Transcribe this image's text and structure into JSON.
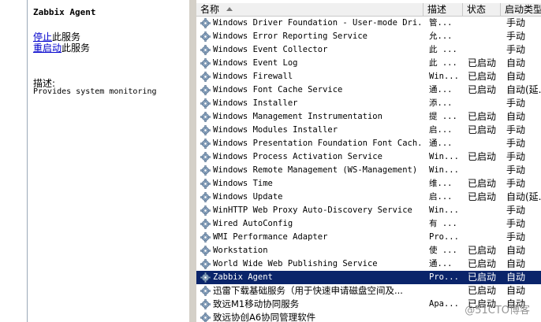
{
  "description_pane": {
    "service_title": "Zabbix Agent",
    "stop_link": "停止",
    "stop_suffix": "此服务",
    "restart_link": "重启动",
    "restart_suffix": "此服务",
    "description_label": "描述:",
    "description_text": "Provides system monitoring"
  },
  "columns": {
    "name": "名称",
    "description": "描述",
    "status": "状态",
    "startup": "启动类型"
  },
  "services": [
    {
      "name": "Windows Driver Foundation - User-mode Dri...",
      "desc": "管...",
      "status": "",
      "startup": "手动"
    },
    {
      "name": "Windows Error Reporting Service",
      "desc": "允...",
      "status": "",
      "startup": "手动"
    },
    {
      "name": "Windows Event Collector",
      "desc": "此 ...",
      "status": "",
      "startup": "手动"
    },
    {
      "name": "Windows Event Log",
      "desc": "此 ...",
      "status": "已启动",
      "startup": "自动"
    },
    {
      "name": "Windows Firewall",
      "desc": "Win...",
      "status": "已启动",
      "startup": "自动"
    },
    {
      "name": "Windows Font Cache Service",
      "desc": "通...",
      "status": "已启动",
      "startup": "自动(延..."
    },
    {
      "name": "Windows Installer",
      "desc": "添...",
      "status": "",
      "startup": "手动"
    },
    {
      "name": "Windows Management Instrumentation",
      "desc": "提 ...",
      "status": "已启动",
      "startup": "自动"
    },
    {
      "name": "Windows Modules Installer",
      "desc": "启...",
      "status": "已启动",
      "startup": "手动"
    },
    {
      "name": "Windows Presentation Foundation Font Cach...",
      "desc": "通...",
      "status": "",
      "startup": "手动"
    },
    {
      "name": "Windows Process Activation Service",
      "desc": "Win...",
      "status": "已启动",
      "startup": "手动"
    },
    {
      "name": "Windows Remote Management (WS-Management)",
      "desc": "Win...",
      "status": "",
      "startup": "手动"
    },
    {
      "name": "Windows Time",
      "desc": "维...",
      "status": "已启动",
      "startup": "手动"
    },
    {
      "name": "Windows Update",
      "desc": "启...",
      "status": "已启动",
      "startup": "自动(延..."
    },
    {
      "name": "WinHTTP Web Proxy Auto-Discovery Service",
      "desc": "Win...",
      "status": "",
      "startup": "手动"
    },
    {
      "name": "Wired AutoConfig",
      "desc": "有 ...",
      "status": "",
      "startup": "手动"
    },
    {
      "name": "WMI Performance Adapter",
      "desc": "Pro...",
      "status": "",
      "startup": "手动"
    },
    {
      "name": "Workstation",
      "desc": "使 ...",
      "status": "已启动",
      "startup": "自动"
    },
    {
      "name": "World Wide Web Publishing Service",
      "desc": "通...",
      "status": "已启动",
      "startup": "自动"
    },
    {
      "name": "Zabbix Agent",
      "desc": "Pro...",
      "status": "已启动",
      "startup": "自动",
      "selected": true
    },
    {
      "name": "迅雷下载基础服务（用于快速申请磁盘空间及...",
      "desc": "",
      "status": "已启动",
      "startup": "自动",
      "cjk": true
    },
    {
      "name": "致远M1移动协同服务",
      "desc": "Apa...",
      "status": "已启动",
      "startup": "自动",
      "cjk": true
    },
    {
      "name": "致远协创A6协同管理软件",
      "desc": "",
      "status": "",
      "startup": "",
      "cjk": true
    }
  ],
  "watermark": "@51CTO博客"
}
